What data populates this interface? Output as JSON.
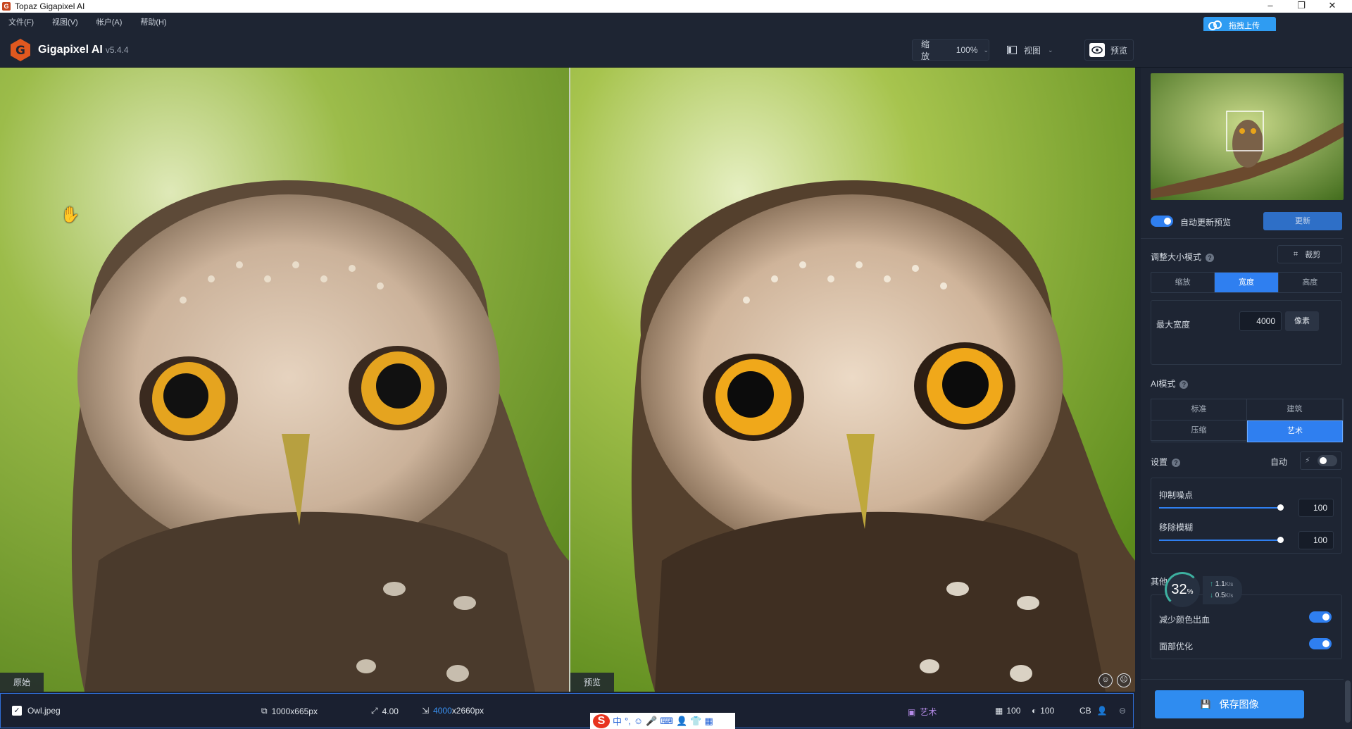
{
  "window": {
    "title": "Topaz Gigapixel AI",
    "controls": [
      "–",
      "❐",
      "✕"
    ]
  },
  "menu": [
    "文件(F)",
    "视图(V)",
    "帐户(A)",
    "帮助(H)"
  ],
  "upload_button": "拖拽上传",
  "app": {
    "name": "Gigapixel AI",
    "version": "v5.4.4"
  },
  "toolbar": {
    "zoom_label": "缩放",
    "zoom_value": "100%",
    "view_label": "视图",
    "preview_label": "预览"
  },
  "viewer": {
    "left_label": "原始",
    "right_label": "预览"
  },
  "statusbar": {
    "filename": "Owl.jpeg",
    "source_size": "1000x665px",
    "scale": "4.00",
    "output_width": "4000",
    "output_rest": "x2660px",
    "mode": "艺术",
    "noise": "100",
    "blur": "100",
    "color": "CB"
  },
  "ime": [
    "中",
    "°,",
    "☺",
    "🎤",
    "⌨",
    "👤",
    "👕",
    "▦"
  ],
  "sidebar": {
    "auto_update_label": "自动更新预览",
    "update_button": "更新",
    "resize_title": "调整大小模式",
    "crop_button": "裁剪",
    "resize_modes": [
      "缩放",
      "宽度",
      "高度"
    ],
    "resize_active": "宽度",
    "max_width_label": "最大宽度",
    "max_width_value": "4000",
    "unit_button": "像素",
    "ai_mode_title": "AI模式",
    "ai_modes": [
      "标准",
      "建筑",
      "压缩",
      "艺术"
    ],
    "ai_mode_active": "艺术",
    "settings_title": "设置",
    "auto_label": "自动",
    "noise_label": "抑制噪点",
    "noise_value": "100",
    "noise_level": 1.0,
    "blur_label": "移除模糊",
    "blur_value": "100",
    "blur_level": 1.0,
    "other_title": "其他",
    "color_bleed_label": "减少颜色出血",
    "face_label": "面部优化",
    "save_button": "保存图像"
  },
  "overlay": {
    "cpu_percent": "32",
    "cpu_unit": "%",
    "up_speed": "1.1",
    "down_speed": "0.5",
    "speed_unit": "K/s"
  }
}
